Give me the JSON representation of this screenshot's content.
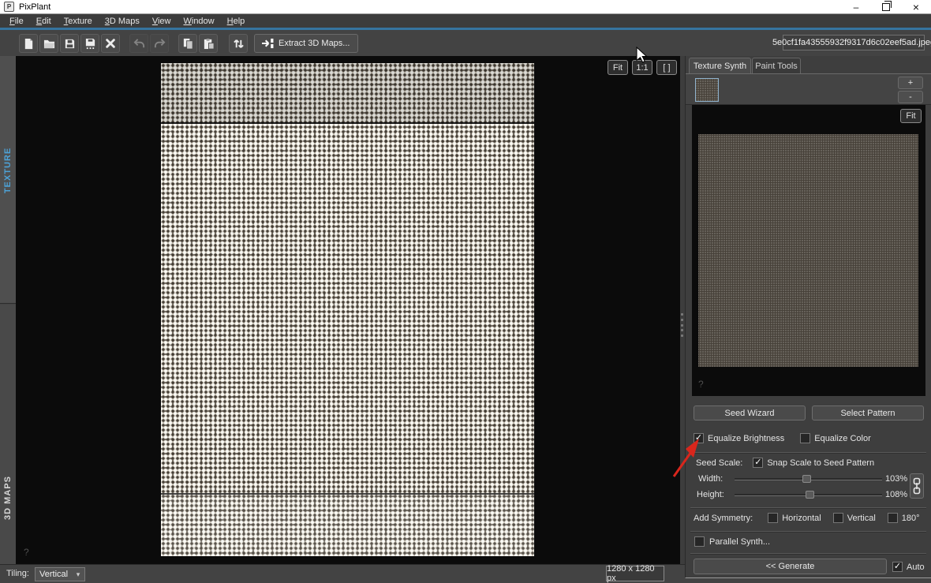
{
  "window": {
    "title": "PixPlant",
    "logo_letter": "P"
  },
  "icons": {
    "check": "✓",
    "dropdown_arrow": "▾",
    "minimize": "–",
    "close": "×",
    "plus": "+",
    "minus": "-"
  },
  "menu": {
    "items": [
      {
        "label": "File"
      },
      {
        "label": "Edit"
      },
      {
        "label": "Texture"
      },
      {
        "label": "3D Maps"
      },
      {
        "label": "View"
      },
      {
        "label": "Window"
      },
      {
        "label": "Help"
      }
    ]
  },
  "toolbar": {
    "extract_button": "Extract 3D Maps...",
    "filename": "5e0cf1fa43555932f9317d6c02eef5ad.jpeg"
  },
  "sidebar": {
    "texture_label": "TEXTURE",
    "maps_label": "3D MAPS"
  },
  "canvas": {
    "fit": "Fit",
    "one_to_one": "1:1",
    "brackets": "[ ]",
    "help": "?",
    "size_label": "1280 x 1280 px"
  },
  "right_panel": {
    "tabs": [
      {
        "label": "Texture Synth",
        "active": true
      },
      {
        "label": "Paint Tools",
        "active": false
      }
    ],
    "preview_fit": "Fit",
    "preview_help": "?",
    "seed_wizard": "Seed Wizard",
    "select_pattern": "Select Pattern",
    "equalize_brightness": {
      "label": "Equalize Brightness",
      "checked": true
    },
    "equalize_color": {
      "label": "Equalize Color",
      "checked": false
    },
    "seed_scale_label": "Seed Scale:",
    "snap_scale": {
      "label": "Snap Scale to Seed Pattern",
      "checked": true
    },
    "width": {
      "label": "Width:",
      "value": "103%"
    },
    "height": {
      "label": "Height:",
      "value": "108%"
    },
    "add_symmetry_label": "Add Symmetry:",
    "symmetry": [
      {
        "label": "Horizontal",
        "checked": false
      },
      {
        "label": "Vertical",
        "checked": false
      },
      {
        "label": "180°",
        "checked": false
      }
    ],
    "parallel_synth": {
      "label": "Parallel Synth...",
      "checked": false
    },
    "generate": "<< Generate",
    "auto": {
      "label": "Auto",
      "checked": true
    }
  },
  "bottom_bar": {
    "tiling_label": "Tiling:",
    "tiling_value": "Vertical"
  },
  "colors": {
    "accent_blue": "#35749f",
    "texture_label_blue": "#4da3d8",
    "annotation_red": "#d9261c"
  }
}
